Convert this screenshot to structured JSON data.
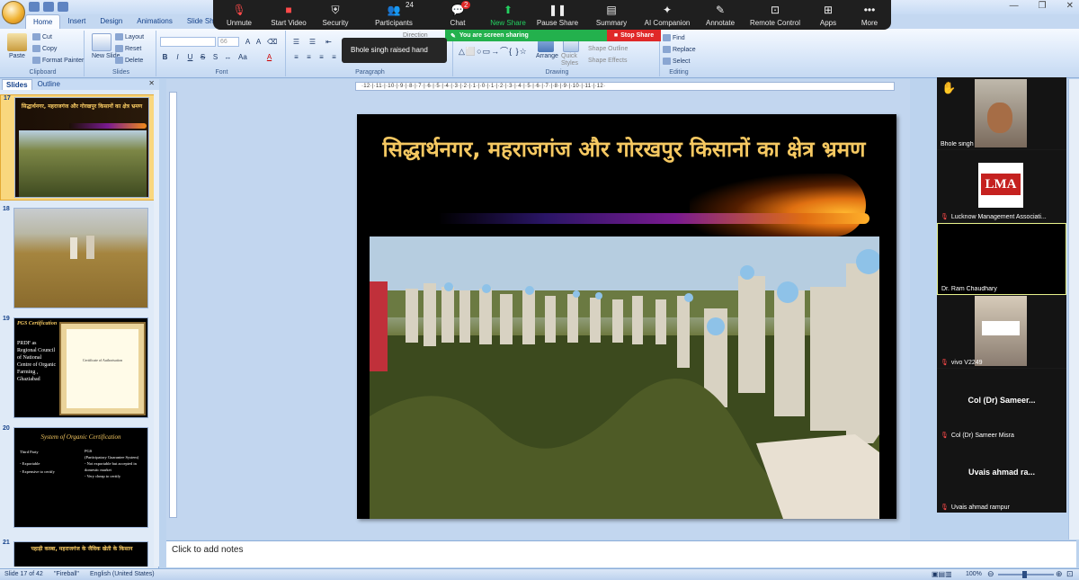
{
  "app": {
    "tabs": [
      "Home",
      "Insert",
      "Design",
      "Animations",
      "Slide Show"
    ],
    "active_tab": "Home"
  },
  "ribbon": {
    "clipboard": {
      "label": "Clipboard",
      "paste": "Paste",
      "cut": "Cut",
      "copy": "Copy",
      "format_painter": "Format Painter"
    },
    "slides": {
      "label": "Slides",
      "new_slide": "New Slide",
      "layout": "Layout",
      "reset": "Reset",
      "delete": "Delete"
    },
    "font": {
      "label": "Font",
      "size": "66"
    },
    "paragraph": {
      "label": "Paragraph",
      "direction": "Direction"
    },
    "drawing": {
      "label": "Drawing",
      "arrange": "Arrange",
      "quick_styles": "Quick Styles",
      "shape_outline": "Shape Outline",
      "shape_effects": "Shape Effects"
    },
    "editing": {
      "label": "Editing",
      "find": "Find",
      "replace": "Replace",
      "select": "Select"
    }
  },
  "zoom_toolbar": {
    "unmute": "Unmute",
    "start_video": "Start Video",
    "security": "Security",
    "participants": "Participants",
    "participants_count": "24",
    "chat": "Chat",
    "chat_badge": "2",
    "new_share": "New Share",
    "pause_share": "Pause Share",
    "summary": "Summary",
    "ai_companion": "AI Companion",
    "annotate": "Annotate",
    "remote_control": "Remote Control",
    "apps": "Apps",
    "more": "More"
  },
  "share_banner": {
    "sharing": "You are screen sharing",
    "stop": "Stop Share"
  },
  "tooltip": "Bhole singh raised hand",
  "left_panel": {
    "tabs": [
      "Slides",
      "Outline"
    ],
    "thumbs": [
      {
        "num": "17",
        "title": "सिद्धार्थनगर, महराजगंज और गोरखपुर किसानों का क्षेत्र भ्रमण"
      },
      {
        "num": "18",
        "title": ""
      },
      {
        "num": "19",
        "title": "PGS Certification",
        "body": "PRDF as Regional Council of National Centre of Organic Farming , Ghaziabad",
        "cert": "Certificate of Authorisation"
      },
      {
        "num": "20",
        "title": "System of Organic Certification",
        "col1": [
          "Third Party",
          "- Exportable",
          "- Expensive to certify"
        ],
        "col2": [
          "PGS",
          "(Participatory Guarantee System)",
          "- Not exportable but accepted in domestic market",
          "- Very cheap to certify"
        ]
      },
      {
        "num": "21",
        "title": "पहाड़ी कस्बा, महराजगंज के जैविक खेती के किसान"
      }
    ]
  },
  "slide": {
    "title": "सिद्धार्थनगर, महराजगंज और गोरखपुर किसानों का क्षेत्र भ्रमण",
    "ruler": "·12·|·11·|·10·|·9·|·8·|·7·|·6·|·5·|·4·|·3·|·2·|·1·|·0·|·1·|·2·|·3·|·4·|·5·|·6·|·7·|·8·|·9·|·10·|·11·|·12·"
  },
  "notes": "Click to add notes",
  "status": {
    "slide": "Slide 17 of 42",
    "theme": "\"Fireball\"",
    "language": "English (United States)",
    "zoom": "100%"
  },
  "gallery": [
    {
      "name": "Bhole singh",
      "hand": "✋"
    },
    {
      "name": "Lucknow Management Associati...",
      "logo": "LMA"
    },
    {
      "name": "Dr. Ram Chaudhary"
    },
    {
      "name": "vivo V2249"
    },
    {
      "big": "Col (Dr) Sameer...",
      "name": "Col (Dr) Sameer Misra"
    },
    {
      "big": "Uvais ahmad ra...",
      "name": "Uvais ahmad rampur"
    }
  ]
}
